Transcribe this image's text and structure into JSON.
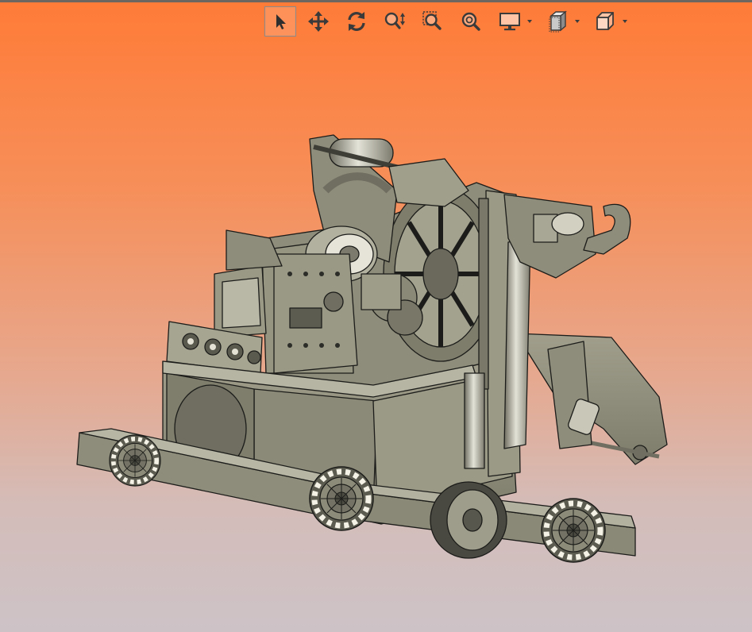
{
  "toolbar": {
    "tools": [
      {
        "id": "select",
        "icon": "arrow-pointer-icon",
        "active": true,
        "has_dropdown": false
      },
      {
        "id": "pan",
        "icon": "move-arrows-icon",
        "active": false,
        "has_dropdown": false
      },
      {
        "id": "rotate",
        "icon": "rotate-icon",
        "active": false,
        "has_dropdown": false
      },
      {
        "id": "zoom",
        "icon": "zoom-updown-icon",
        "active": false,
        "has_dropdown": false
      },
      {
        "id": "zoom-window",
        "icon": "zoom-window-icon",
        "active": false,
        "has_dropdown": false
      },
      {
        "id": "zoom-fit",
        "icon": "zoom-fit-icon",
        "active": false,
        "has_dropdown": false
      },
      {
        "id": "display",
        "icon": "monitor-icon",
        "active": false,
        "has_dropdown": true
      },
      {
        "id": "section",
        "icon": "section-plane-icon",
        "active": false,
        "has_dropdown": true
      },
      {
        "id": "view-orientation",
        "icon": "cube-icon",
        "active": false,
        "has_dropdown": true
      }
    ]
  },
  "colors": {
    "background_top": "#ff7b37",
    "background_bottom": "#cdc3c7",
    "model_face": "#8e8d7b",
    "model_dark": "#6f6e60",
    "model_edge": "#1c1c1a",
    "toolbar_icon": "#3a3a3a"
  },
  "model": {
    "icon": "robot-assembly-model",
    "label": ""
  }
}
